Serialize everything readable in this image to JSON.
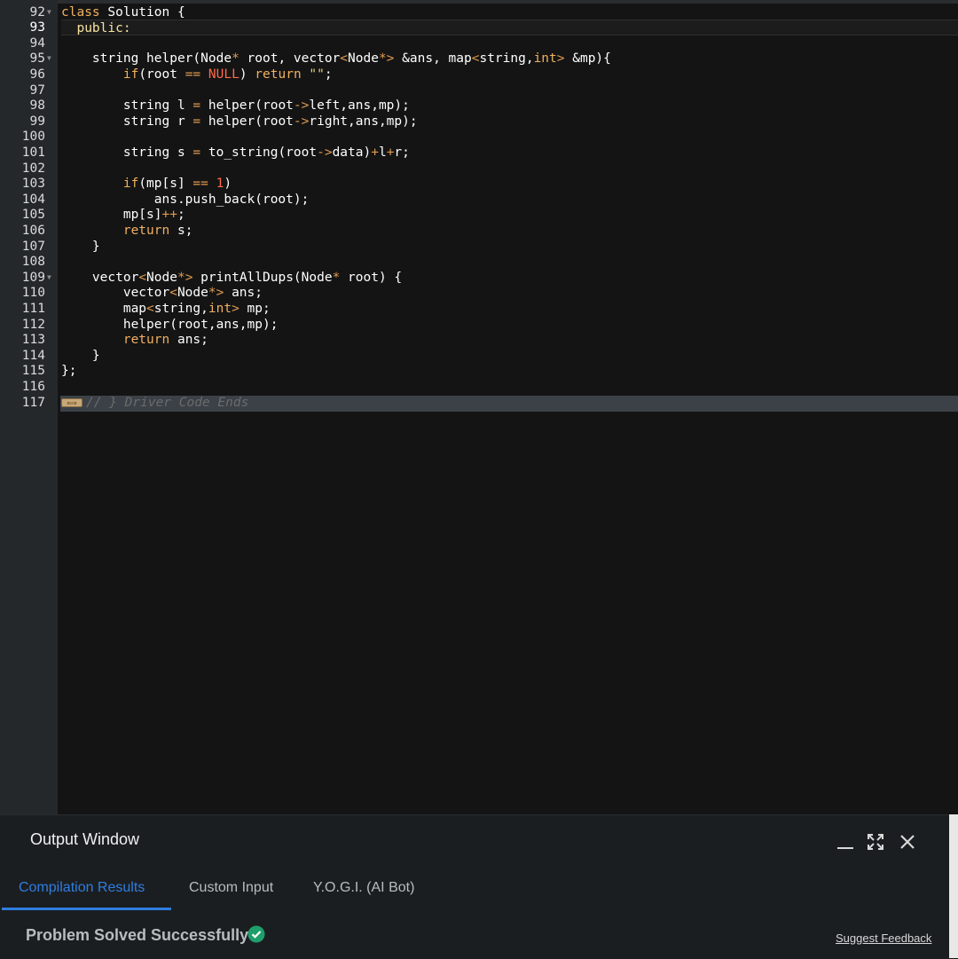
{
  "editor": {
    "lines": [
      {
        "num": "92",
        "fold": true,
        "active": false,
        "tokens": [
          [
            "kw",
            "class"
          ],
          [
            "ty",
            " Solution {"
          ]
        ]
      },
      {
        "num": "93",
        "fold": false,
        "active": true,
        "tokens": [
          [
            "pub",
            "  public:"
          ]
        ]
      },
      {
        "num": "94",
        "fold": false,
        "active": false,
        "tokens": []
      },
      {
        "num": "95",
        "fold": true,
        "active": false,
        "tokens": [
          [
            "ty",
            "    string helper(Node"
          ],
          [
            "op",
            "*"
          ],
          [
            "ty",
            " root, vector"
          ],
          [
            "op",
            "<"
          ],
          [
            "ty",
            "Node"
          ],
          [
            "op",
            "*>"
          ],
          [
            "ty",
            " &ans, map"
          ],
          [
            "op",
            "<"
          ],
          [
            "ty",
            "string,"
          ],
          [
            "kw",
            "int"
          ],
          [
            "op",
            ">"
          ],
          [
            "ty",
            " &mp){"
          ]
        ]
      },
      {
        "num": "96",
        "fold": false,
        "active": false,
        "tokens": [
          [
            "ty",
            "        "
          ],
          [
            "kw",
            "if"
          ],
          [
            "ty",
            "(root "
          ],
          [
            "op",
            "=="
          ],
          [
            "ty",
            " "
          ],
          [
            "num",
            "NULL"
          ],
          [
            "ty",
            ") "
          ],
          [
            "kw",
            "return"
          ],
          [
            "ty",
            " "
          ],
          [
            "str",
            "\"\""
          ],
          [
            "ty",
            ";"
          ]
        ]
      },
      {
        "num": "97",
        "fold": false,
        "active": false,
        "tokens": []
      },
      {
        "num": "98",
        "fold": false,
        "active": false,
        "tokens": [
          [
            "ty",
            "        string l "
          ],
          [
            "op",
            "="
          ],
          [
            "ty",
            " helper(root"
          ],
          [
            "op",
            "->"
          ],
          [
            "ty",
            "left,ans,mp);"
          ]
        ]
      },
      {
        "num": "99",
        "fold": false,
        "active": false,
        "tokens": [
          [
            "ty",
            "        string r "
          ],
          [
            "op",
            "="
          ],
          [
            "ty",
            " helper(root"
          ],
          [
            "op",
            "->"
          ],
          [
            "ty",
            "right,ans,mp);"
          ]
        ]
      },
      {
        "num": "100",
        "fold": false,
        "active": false,
        "tokens": []
      },
      {
        "num": "101",
        "fold": false,
        "active": false,
        "tokens": [
          [
            "ty",
            "        string s "
          ],
          [
            "op",
            "="
          ],
          [
            "ty",
            " to_string(root"
          ],
          [
            "op",
            "->"
          ],
          [
            "ty",
            "data)"
          ],
          [
            "op",
            "+"
          ],
          [
            "ty",
            "l"
          ],
          [
            "op",
            "+"
          ],
          [
            "ty",
            "r;"
          ]
        ]
      },
      {
        "num": "102",
        "fold": false,
        "active": false,
        "tokens": []
      },
      {
        "num": "103",
        "fold": false,
        "active": false,
        "tokens": [
          [
            "ty",
            "        "
          ],
          [
            "kw",
            "if"
          ],
          [
            "ty",
            "(mp[s] "
          ],
          [
            "op",
            "=="
          ],
          [
            "ty",
            " "
          ],
          [
            "num",
            "1"
          ],
          [
            "ty",
            ")"
          ]
        ]
      },
      {
        "num": "104",
        "fold": false,
        "active": false,
        "tokens": [
          [
            "ty",
            "            ans.push_back(root);"
          ]
        ]
      },
      {
        "num": "105",
        "fold": false,
        "active": false,
        "tokens": [
          [
            "ty",
            "        mp[s]"
          ],
          [
            "op",
            "++"
          ],
          [
            "ty",
            ";"
          ]
        ]
      },
      {
        "num": "106",
        "fold": false,
        "active": false,
        "tokens": [
          [
            "ty",
            "        "
          ],
          [
            "kw",
            "return"
          ],
          [
            "ty",
            " s;"
          ]
        ]
      },
      {
        "num": "107",
        "fold": false,
        "active": false,
        "tokens": [
          [
            "ty",
            "    }"
          ]
        ]
      },
      {
        "num": "108",
        "fold": false,
        "active": false,
        "tokens": []
      },
      {
        "num": "109",
        "fold": true,
        "active": false,
        "tokens": [
          [
            "ty",
            "    vector"
          ],
          [
            "op",
            "<"
          ],
          [
            "ty",
            "Node"
          ],
          [
            "op",
            "*>"
          ],
          [
            "ty",
            " printAllDups(Node"
          ],
          [
            "op",
            "*"
          ],
          [
            "ty",
            " root) {"
          ]
        ]
      },
      {
        "num": "110",
        "fold": false,
        "active": false,
        "tokens": [
          [
            "ty",
            "        vector"
          ],
          [
            "op",
            "<"
          ],
          [
            "ty",
            "Node"
          ],
          [
            "op",
            "*>"
          ],
          [
            "ty",
            " ans;"
          ]
        ]
      },
      {
        "num": "111",
        "fold": false,
        "active": false,
        "tokens": [
          [
            "ty",
            "        map"
          ],
          [
            "op",
            "<"
          ],
          [
            "ty",
            "string,"
          ],
          [
            "kw",
            "int"
          ],
          [
            "op",
            ">"
          ],
          [
            "ty",
            " mp;"
          ]
        ]
      },
      {
        "num": "112",
        "fold": false,
        "active": false,
        "tokens": [
          [
            "ty",
            "        helper(root,ans,mp);"
          ]
        ]
      },
      {
        "num": "113",
        "fold": false,
        "active": false,
        "tokens": [
          [
            "ty",
            "        "
          ],
          [
            "kw",
            "return"
          ],
          [
            "ty",
            " ans;"
          ]
        ]
      },
      {
        "num": "114",
        "fold": false,
        "active": false,
        "tokens": [
          [
            "ty",
            "    }"
          ]
        ]
      },
      {
        "num": "115",
        "fold": false,
        "active": false,
        "tokens": [
          [
            "ty",
            "};"
          ]
        ]
      },
      {
        "num": "116",
        "fold": false,
        "active": false,
        "tokens": []
      },
      {
        "num": "117",
        "fold": false,
        "active": false,
        "folded_widget": true,
        "tokens": [
          [
            "cm",
            "// } Driver Code Ends"
          ]
        ]
      }
    ]
  },
  "output_window": {
    "title": "Output Window",
    "minimize_icon": "minimize-icon",
    "expand_icon": "expand-icon",
    "close_icon": "close-icon",
    "tabs": [
      {
        "label": "Compilation Results",
        "active": true
      },
      {
        "label": "Custom Input",
        "active": false
      },
      {
        "label": "Y.O.G.I. (AI Bot)",
        "active": false
      }
    ],
    "status": "Problem Solved Successfully",
    "status_icon": "check-circle-icon",
    "status_icon_color": "#1e9e6a",
    "feedback_link": "Suggest Feedback"
  },
  "colors": {
    "accent": "#2f7de0",
    "keyword": "#f0b060",
    "number": "#ff6a4a"
  }
}
